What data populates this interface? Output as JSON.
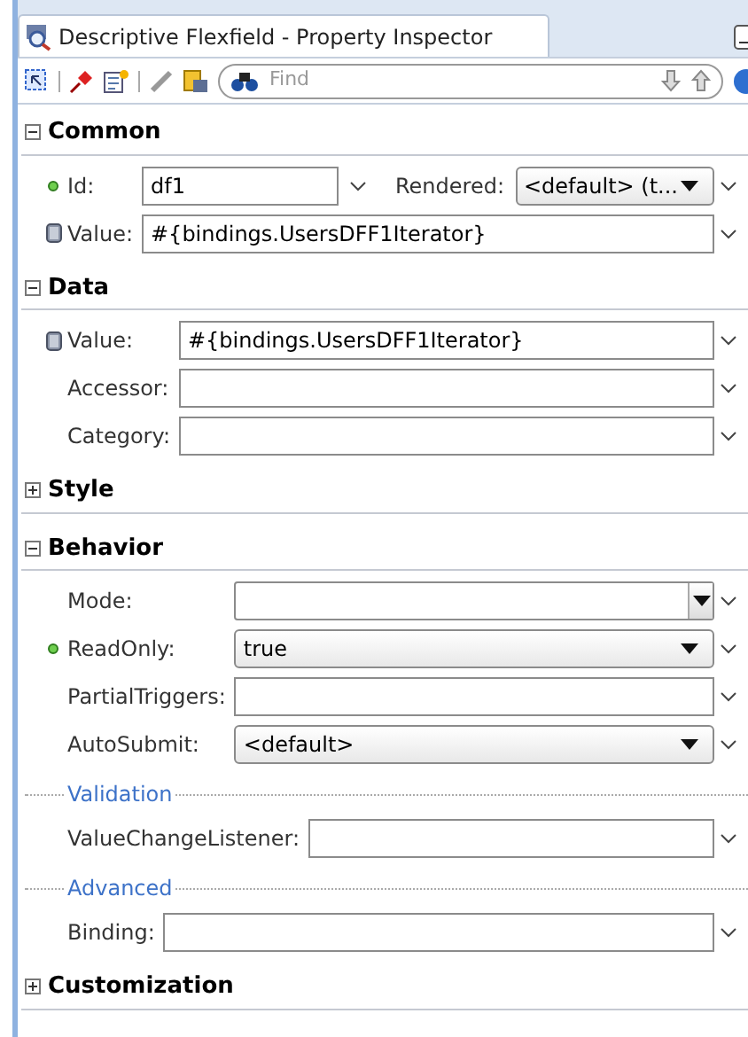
{
  "window": {
    "title": "Descriptive Flexfield - Property Inspector"
  },
  "toolbar": {
    "search": {
      "placeholder": "Find"
    }
  },
  "sections": [
    {
      "title": "Common",
      "expanded": true,
      "items": [
        {
          "kind": "pair",
          "label": "Id:",
          "modified": true,
          "bound": false,
          "value": "df1",
          "second": {
            "label": "Rendered:",
            "value": "<default> (t..."
          }
        },
        {
          "kind": "text",
          "label": "Value:",
          "modified": false,
          "bound": true,
          "value": "#{bindings.UsersDFF1Iterator}"
        }
      ]
    },
    {
      "title": "Data",
      "expanded": true,
      "items": [
        {
          "kind": "text",
          "label": "Value:",
          "modified": false,
          "bound": true,
          "value": "#{bindings.UsersDFF1Iterator}"
        },
        {
          "kind": "text",
          "label": "Accessor:",
          "modified": false,
          "bound": false
        },
        {
          "kind": "text",
          "label": "Category:",
          "modified": false,
          "bound": false
        }
      ]
    },
    {
      "title": "Style",
      "expanded": false
    },
    {
      "title": "Behavior",
      "expanded": true,
      "items": [
        {
          "kind": "combo",
          "label": "Mode:",
          "modified": false,
          "bound": false
        },
        {
          "kind": "select",
          "label": "ReadOnly:",
          "modified": true,
          "bound": false,
          "value": "true"
        },
        {
          "kind": "text",
          "label": "PartialTriggers:",
          "modified": false,
          "bound": false
        },
        {
          "kind": "select",
          "label": "AutoSubmit:",
          "modified": false,
          "bound": false,
          "value": "<default>"
        },
        {
          "kind": "subheader",
          "label": "Validation"
        },
        {
          "kind": "text",
          "label": "ValueChangeListener:",
          "modified": false,
          "bound": false
        },
        {
          "kind": "subheader",
          "label": "Advanced"
        },
        {
          "kind": "text",
          "label": "Binding:",
          "modified": false,
          "bound": false
        }
      ]
    },
    {
      "title": "Customization",
      "expanded": false
    }
  ]
}
